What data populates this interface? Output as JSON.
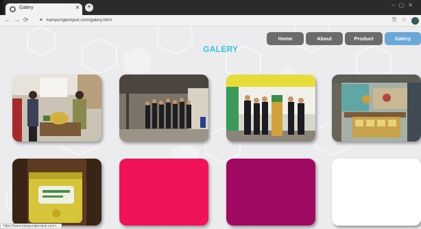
{
  "browser": {
    "tab_title": "Galery",
    "url": "kampungkeripuk.com/galery.html",
    "status_text": "https://www.kampungkeripuk.com/..."
  },
  "page": {
    "title": "GALERY",
    "menu": [
      {
        "label": "Home",
        "active": false
      },
      {
        "label": "About",
        "active": false
      },
      {
        "label": "Product",
        "active": false
      },
      {
        "label": "Galery",
        "active": true
      }
    ]
  },
  "gallery": [
    {
      "kind": "photo",
      "subject": "handshake-ceremony"
    },
    {
      "kind": "photo",
      "subject": "group-in-hall"
    },
    {
      "kind": "photo",
      "subject": "group-with-banner"
    },
    {
      "kind": "photo",
      "subject": "shop-interior"
    },
    {
      "kind": "photo",
      "subject": "packaged-chips"
    },
    {
      "kind": "color",
      "color": "#f0135a"
    },
    {
      "kind": "color",
      "color": "#a10a63"
    },
    {
      "kind": "color",
      "color": "#ffffff"
    }
  ],
  "colors": {
    "title": "#35c4d4",
    "menu_inactive": "#6b6b6b",
    "menu_active": "#6aa8da",
    "page_bg": "#ececee"
  }
}
